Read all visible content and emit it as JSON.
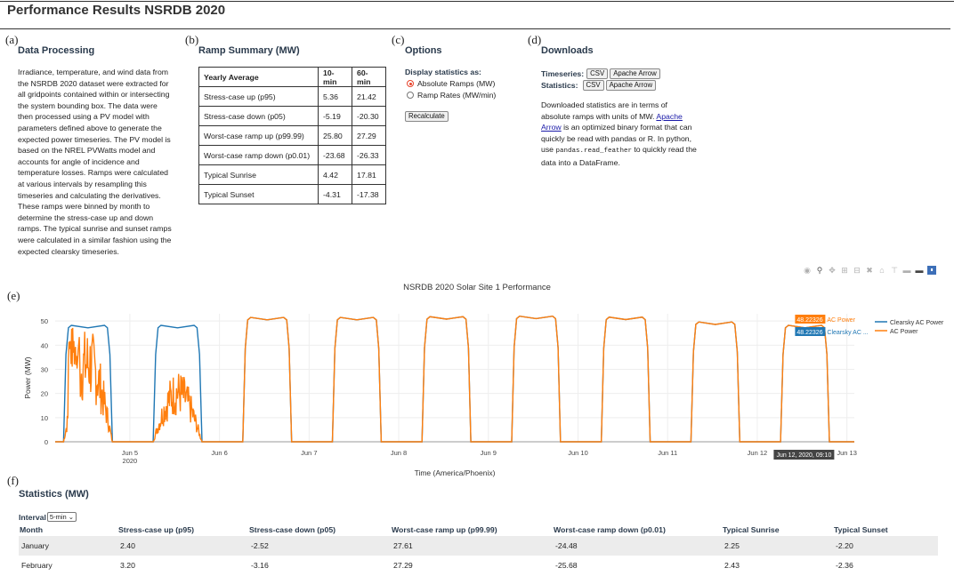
{
  "page_title": "Performance Results NSRDB 2020",
  "panels": {
    "a": "(a)",
    "b": "(b)",
    "c": "(c)",
    "d": "(d)",
    "e": "(e)",
    "f": "(f)"
  },
  "data_processing": {
    "title": "Data Processing",
    "lines": [
      "Irradiance, temperature, and wind data from",
      "the NSRDB 2020 dataset were extracted for",
      "all gridpoints contained within or intersecting",
      "the system bounding box. The data were",
      "then processed using a PV model with",
      "parameters defined above to generate the",
      "expected power timeseries. The PV model is",
      "based on the NREL PVWatts model and",
      "accounts for angle of incidence and",
      "temperature losses. Ramps were calculated",
      "at various intervals by resampling this",
      "timeseries and calculating the derivatives.",
      "These ramps were binned by month to",
      "determine the stress-case up and down",
      "ramps. The typical sunrise and sunset ramps",
      "were calculated in a similar fashion using the",
      "expected clearsky timeseries."
    ]
  },
  "ramp_summary": {
    "title": "Ramp Summary (MW)",
    "headers": [
      "Yearly Average",
      "10-min",
      "60-min"
    ],
    "rows": [
      [
        "Stress-case up (p95)",
        "5.36",
        "21.42"
      ],
      [
        "Stress-case down (p05)",
        "-5.19",
        "-20.30"
      ],
      [
        "Worst-case ramp up (p99.99)",
        "25.80",
        "27.29"
      ],
      [
        "Worst-case ramp down (p0.01)",
        "-23.68",
        "-26.33"
      ],
      [
        "Typical Sunrise",
        "4.42",
        "17.81"
      ],
      [
        "Typical Sunset",
        "-4.31",
        "-17.38"
      ]
    ]
  },
  "options": {
    "title": "Options",
    "display_label": "Display statistics as:",
    "radio_1": "Absolute Ramps (MW)",
    "radio_2": "Ramp Rates (MW/min)",
    "selected": 0,
    "recalculate": "Recalculate"
  },
  "downloads": {
    "title": "Downloads",
    "timeseries_label": "Timeseries:",
    "statistics_label": "Statistics:",
    "csv": "CSV",
    "arrow": "Apache Arrow",
    "text_1": "Downloaded statistics are in terms of",
    "text_2": "absolute ramps with units of MW.",
    "link_1": "Apache",
    "link_2": "Arrow",
    "text_3": "is an optimized binary format that can",
    "text_4": "quickly be read with pandas or R. In python,",
    "text_5a": "use",
    "code": "pandas.read_feather",
    "text_5b": "to quickly read the",
    "text_6": "data into a DataFrame."
  },
  "chart_data": {
    "type": "line",
    "title": "NSRDB 2020 Solar Site 1 Performance",
    "xlabel": "Time (America/Phoenix)",
    "ylabel": "Power (MW)",
    "y_ticks": [
      "0",
      "10",
      "20",
      "30",
      "40",
      "50"
    ],
    "ylim": [
      0,
      53
    ],
    "xlim": [
      "Jun 4, 04:00",
      "Jun 13, 02:00"
    ],
    "x_ticks": [
      "Jun 5",
      "Jun 6",
      "Jun 7",
      "Jun 8",
      "Jun 9",
      "Jun 10",
      "Jun 11",
      "Jun 12",
      "Jun 13"
    ],
    "x_tick_year": "2020",
    "grid": true,
    "legend_placement": "top-right",
    "series": [
      {
        "name": "Clearsky AC Power",
        "color": "#1f77b4",
        "daily_peak_mw": [
          48.2,
          48.2,
          51.5,
          51.5,
          51.8,
          52.0,
          51.6,
          49.6,
          48.2
        ]
      },
      {
        "name": "AC Power",
        "color": "#ff7f0e",
        "daily_peak_mw": [
          48.0,
          30.0,
          51.5,
          51.5,
          51.8,
          52.0,
          51.6,
          49.6,
          48.2
        ],
        "note_pattern": [
          "cloudy",
          "cloudy",
          "clear",
          "clear",
          "clear",
          "clear",
          "clear",
          "clear",
          "clear"
        ]
      }
    ],
    "hover": {
      "value_orange": "48.22326",
      "label_orange": "AC Power",
      "value_blue": "48.22326",
      "label_blue": "Clearsky AC ...",
      "x_label": "Jun 12, 2020, 09:10"
    }
  },
  "modebar_icons": [
    "camera-icon",
    "zoom-icon",
    "pan-icon",
    "zoom-in-icon",
    "zoom-out-icon",
    "autoscale-icon",
    "reset-axes-icon",
    "spike-lines-icon",
    "hover-closest-icon",
    "hover-compare-icon",
    "plotly-logo-icon"
  ],
  "statistics": {
    "title": "Statistics (MW)",
    "interval_label": "Interval",
    "interval_value": "5-min",
    "headers": [
      "Month",
      "Stress-case up (p95)",
      "Stress-case down (p05)",
      "Worst-case ramp up (p99.99)",
      "Worst-case ramp down (p0.01)",
      "Typical Sunrise",
      "Typical Sunset"
    ],
    "rows": [
      [
        "January",
        "2.40",
        "-2.52",
        "27.61",
        "-24.48",
        "2.25",
        "-2.20"
      ],
      [
        "February",
        "3.20",
        "-3.16",
        "27.29",
        "-25.68",
        "2.43",
        "-2.36"
      ]
    ]
  }
}
